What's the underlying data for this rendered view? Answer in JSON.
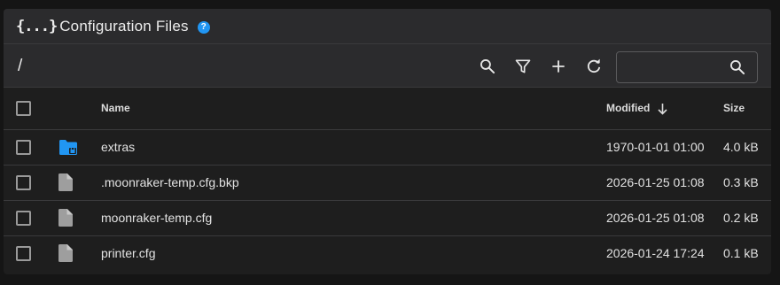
{
  "header": {
    "brace_symbol": "{...}",
    "title": "Configuration Files",
    "help_symbol": "?"
  },
  "toolbar": {
    "path": "/",
    "search_placeholder": ""
  },
  "table": {
    "columns": {
      "name": "Name",
      "modified": "Modified",
      "size": "Size"
    },
    "rows": [
      {
        "type": "folder-locked",
        "name": "extras",
        "modified": "1970-01-01 01:00",
        "size": "4.0 kB"
      },
      {
        "type": "file",
        "name": ".moonraker-temp.cfg.bkp",
        "modified": "2026-01-25 01:08",
        "size": "0.3 kB"
      },
      {
        "type": "file",
        "name": "moonraker-temp.cfg",
        "modified": "2026-01-25 01:08",
        "size": "0.2 kB"
      },
      {
        "type": "file",
        "name": "printer.cfg",
        "modified": "2026-01-24 17:24",
        "size": "0.1 kB"
      }
    ]
  },
  "colors": {
    "accent": "#2196f3",
    "background": "#1e1e1e",
    "header_bg": "#2b2b2d",
    "file_icon": "#9e9e9e"
  }
}
